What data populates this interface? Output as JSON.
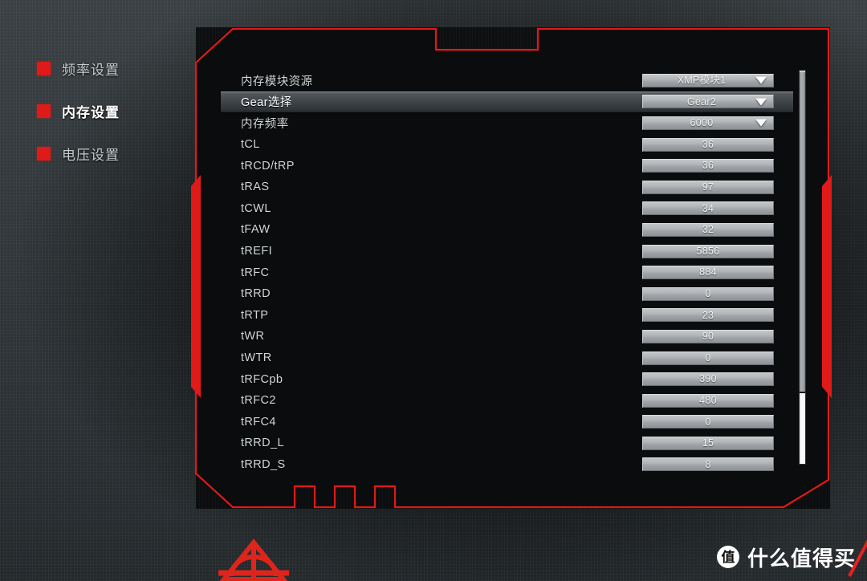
{
  "sidebar": {
    "items": [
      {
        "label": "频率设置",
        "icon": "red-square-bullet",
        "active": false
      },
      {
        "label": "内存设置",
        "icon": "red-square-bullet",
        "active": true
      },
      {
        "label": "电压设置",
        "icon": "red-square-bullet",
        "active": false
      }
    ]
  },
  "panel": {
    "accent_color": "#e01a19",
    "background_color": "#0b0d0f",
    "rows": [
      {
        "label": "内存模块资源",
        "value": "XMP模块1",
        "type": "dropdown",
        "selected": false
      },
      {
        "label": "Gear选择",
        "value": "Gear2",
        "type": "dropdown",
        "selected": true
      },
      {
        "label": "内存频率",
        "value": "6000",
        "type": "dropdown",
        "selected": false
      },
      {
        "label": "tCL",
        "value": "36",
        "type": "field",
        "selected": false
      },
      {
        "label": "tRCD/tRP",
        "value": "36",
        "type": "field",
        "selected": false
      },
      {
        "label": "tRAS",
        "value": "97",
        "type": "field",
        "selected": false
      },
      {
        "label": "tCWL",
        "value": "34",
        "type": "field",
        "selected": false
      },
      {
        "label": "tFAW",
        "value": "32",
        "type": "field",
        "selected": false
      },
      {
        "label": "tREFI",
        "value": "5856",
        "type": "field",
        "selected": false
      },
      {
        "label": "tRFC",
        "value": "884",
        "type": "field",
        "selected": false
      },
      {
        "label": "tRRD",
        "value": "0",
        "type": "field",
        "selected": false
      },
      {
        "label": "tRTP",
        "value": "23",
        "type": "field",
        "selected": false
      },
      {
        "label": "tWR",
        "value": "90",
        "type": "field",
        "selected": false
      },
      {
        "label": "tWTR",
        "value": "0",
        "type": "field",
        "selected": false
      },
      {
        "label": "tRFCpb",
        "value": "390",
        "type": "field",
        "selected": false
      },
      {
        "label": "tRFC2",
        "value": "480",
        "type": "field",
        "selected": false
      },
      {
        "label": "tRFC4",
        "value": "0",
        "type": "field",
        "selected": false
      },
      {
        "label": "tRRD_L",
        "value": "15",
        "type": "field",
        "selected": false
      },
      {
        "label": "tRRD_S",
        "value": "8",
        "type": "field",
        "selected": false
      }
    ]
  },
  "scrollbar": {
    "icon": "vertical-scrollbar",
    "thumb_position_percent": 0
  },
  "logo": {
    "icon": "red-triangle-emblem"
  },
  "watermark": {
    "badge": "值",
    "text": "什么值得买",
    "accent_color": "#e8211f"
  }
}
